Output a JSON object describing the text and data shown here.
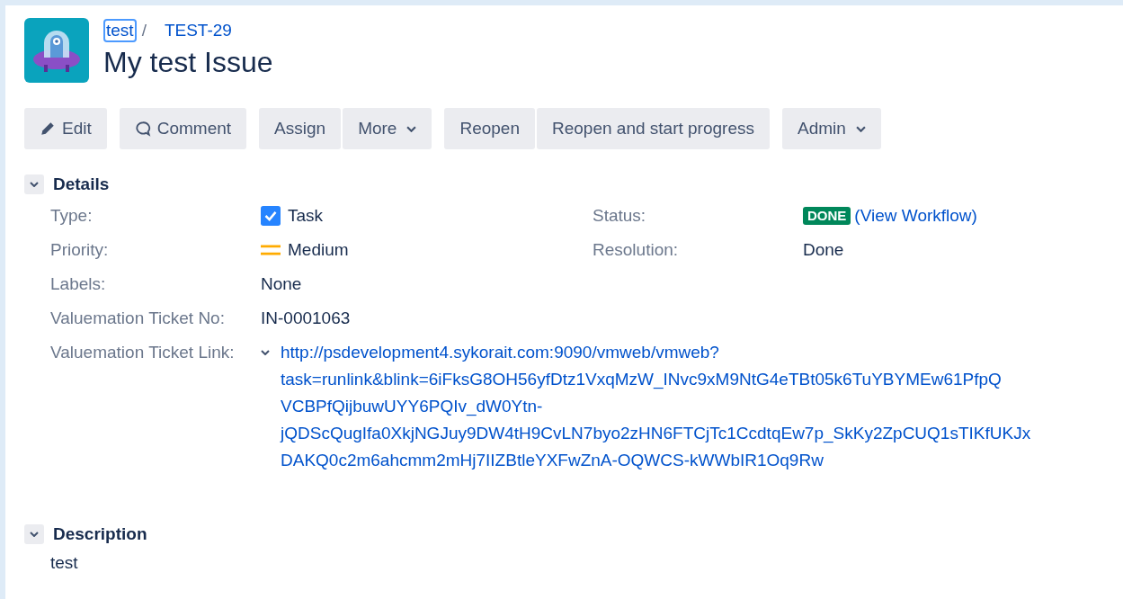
{
  "breadcrumb": {
    "project": "test",
    "separator": "/",
    "issue_key": "TEST-29"
  },
  "title": "My test Issue",
  "toolbar": [
    {
      "buttons": [
        {
          "kind": "edit",
          "label": "Edit",
          "dropdown": false
        }
      ]
    },
    {
      "buttons": [
        {
          "kind": "comment",
          "label": "Comment",
          "dropdown": false
        }
      ]
    },
    {
      "buttons": [
        {
          "kind": "plain",
          "label": "Assign",
          "dropdown": false
        },
        {
          "kind": "plain",
          "label": "More",
          "dropdown": true
        }
      ]
    },
    {
      "buttons": [
        {
          "kind": "plain",
          "label": "Reopen",
          "dropdown": false
        },
        {
          "kind": "plain",
          "label": "Reopen and start progress",
          "dropdown": false
        }
      ]
    },
    {
      "buttons": [
        {
          "kind": "plain",
          "label": "Admin",
          "dropdown": true
        }
      ]
    }
  ],
  "details": {
    "title": "Details",
    "expanded": true,
    "rows": [
      {
        "cells": [
          {
            "kind": "issue_type",
            "label": "Type:",
            "value": "Task"
          },
          {
            "kind": "status",
            "label": "Status:",
            "value": "DONE",
            "link": "(View Workflow)"
          }
        ]
      },
      {
        "cells": [
          {
            "kind": "priority",
            "label": "Priority:",
            "value": "Medium"
          },
          {
            "kind": "text",
            "label": "Resolution:",
            "value": "Done"
          }
        ]
      },
      {
        "cells": [
          {
            "kind": "text",
            "label": "Labels:",
            "value": "None"
          }
        ]
      },
      {
        "cells": [
          {
            "kind": "text",
            "label": "Valuemation Ticket No:",
            "value": "IN-0001063"
          }
        ]
      },
      {
        "cells": [
          {
            "kind": "link",
            "label": "Valuemation Ticket Link:",
            "expanded": true,
            "lines": [
              "http://psdevelopment4.sykorait.com:9090/vmweb/vmweb?",
              "task=runlink&blink=6iFksG8OH56yfDtz1VxqMzW_INvc9xM9NtG4eTBt05k6TuYBYMEw61PfpQ",
              "VCBPfQijbuwUYY6PQIv_dW0Ytn-",
              "jQDScQugIfa0XkjNGJuy9DW4tH9CvLN7byo2zHN6FTCjTc1CcdtqEw7p_SkKy2ZpCUQ1sTIKfUKJx",
              "DAKQ0c2m6ahcmm2mHj7IIZBtleYXFwZnA-OQWCS-kWWbIR1Oq9Rw"
            ]
          }
        ]
      }
    ]
  },
  "description": {
    "title": "Description",
    "expanded": true,
    "text": "test"
  }
}
